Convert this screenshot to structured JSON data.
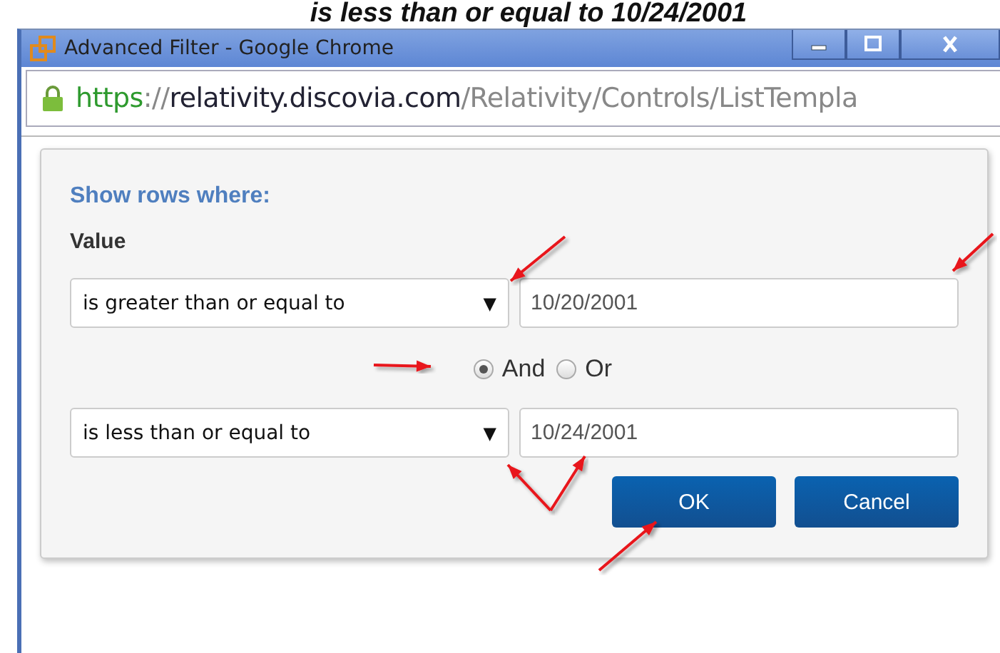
{
  "caption": "is less than or equal to 10/24/2001",
  "window": {
    "title": "Advanced Filter - Google Chrome"
  },
  "address_bar": {
    "scheme": "https",
    "separator": "://",
    "host": "relativity.discovia.com",
    "path": "/Relativity/Controls/ListTempla"
  },
  "dialog": {
    "heading": "Show rows where:",
    "field_label": "Value",
    "conditions": [
      {
        "operator": "is greater than or equal to",
        "caret": "▼",
        "value": "10/20/2001"
      },
      {
        "operator": "is less than or equal to",
        "caret": "▼",
        "value": "10/24/2001"
      }
    ],
    "logic": [
      {
        "label": "And",
        "selected": true
      },
      {
        "label": "Or",
        "selected": false
      }
    ],
    "buttons": [
      "OK",
      "Cancel"
    ]
  }
}
